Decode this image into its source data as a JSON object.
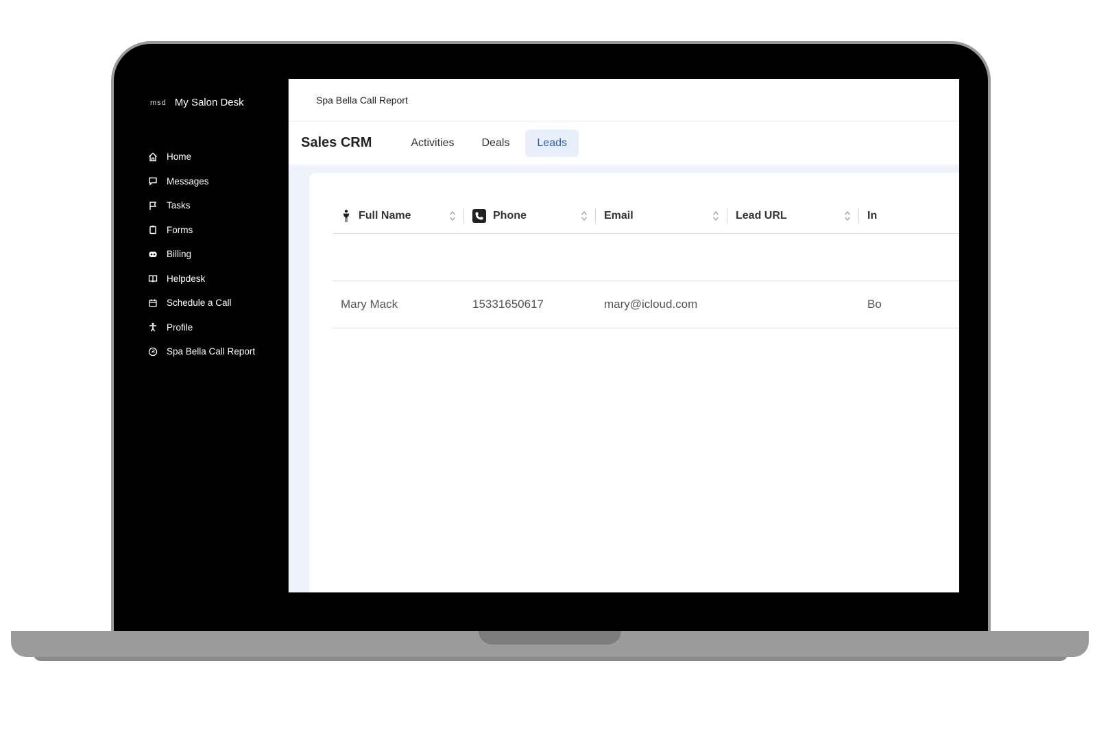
{
  "sidebar": {
    "brand_mark": "msd",
    "brand_name": "My Salon Desk",
    "items": [
      {
        "label": "Home",
        "icon": "home-icon"
      },
      {
        "label": "Messages",
        "icon": "message-icon"
      },
      {
        "label": "Tasks",
        "icon": "flag-icon"
      },
      {
        "label": "Forms",
        "icon": "clipboard-icon"
      },
      {
        "label": "Billing",
        "icon": "billing-icon"
      },
      {
        "label": "Helpdesk",
        "icon": "book-icon"
      },
      {
        "label": "Schedule a Call",
        "icon": "calendar-icon"
      },
      {
        "label": "Profile",
        "icon": "person-icon"
      },
      {
        "label": "Spa Bella Call Report",
        "icon": "gauge-icon"
      }
    ]
  },
  "header": {
    "title": "Spa Bella Call Report"
  },
  "crm": {
    "title": "Sales CRM",
    "tabs": [
      {
        "label": "Activities",
        "active": false
      },
      {
        "label": "Deals",
        "active": false
      },
      {
        "label": "Leads",
        "active": true
      }
    ]
  },
  "table": {
    "columns": [
      {
        "label": "Full Name",
        "icon": "person-icon"
      },
      {
        "label": "Phone",
        "icon": "phone-icon"
      },
      {
        "label": "Email",
        "icon": ""
      },
      {
        "label": "Lead URL",
        "icon": ""
      },
      {
        "label": "In",
        "icon": ""
      }
    ],
    "rows": [
      {
        "full_name": "Mary Mack",
        "phone": "15331650617",
        "email": "mary@icloud.com",
        "lead_url": "",
        "extra": "Bo"
      }
    ]
  },
  "colors": {
    "accent": "#2f5fb8",
    "active_tab_bg": "#e9effa",
    "sidebar_bg": "#000000"
  }
}
